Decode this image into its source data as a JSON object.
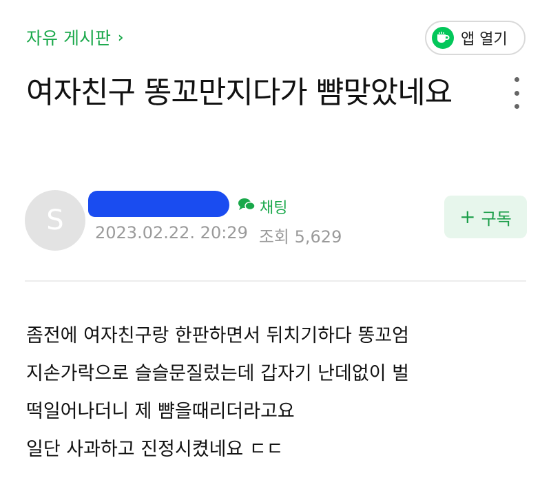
{
  "header": {
    "board_label": "자유 게시판",
    "board_chevron": "›",
    "app_button_label": "앱 열기",
    "app_icon": "cup-icon"
  },
  "post": {
    "title": "여자친구 똥꼬만지다가 뺨맞았네요",
    "more_icon": "more-vertical-icon",
    "author": {
      "avatar_letter": "S",
      "name": "",
      "chat_label": "채팅",
      "chat_icon": "chat-bubbles-icon"
    },
    "date": "2023.02.22. 20:29",
    "views_label": "조회 5,629",
    "subscribe_label": "구독",
    "subscribe_icon": "plus-icon",
    "body_lines": [
      "좀전에 여자친구랑 한판하면서 뒤치기하다 똥꼬엄",
      "지손가락으로 슬슬문질렀는데 갑자기 난데없이 벌",
      "떡일어나더니 제 뺨을때리더라고요",
      "일단 사과하고 진정시켰네요 ㄷㄷ"
    ]
  },
  "colors": {
    "accent_green": "#19a84a",
    "app_icon_green": "#03c75a",
    "subscribe_bg": "#e7f6ec",
    "redaction_blue": "#1a4cf0"
  }
}
